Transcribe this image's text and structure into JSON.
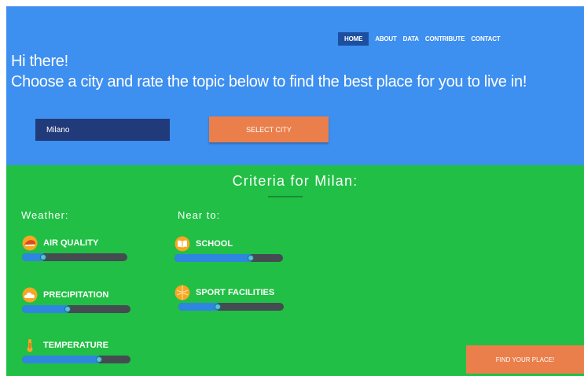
{
  "nav": {
    "items": [
      {
        "label": "HOME",
        "active": true
      },
      {
        "label": "ABOUT",
        "active": false
      },
      {
        "label": "DATA",
        "active": false
      },
      {
        "label": "CONTRIBUTE",
        "active": false
      },
      {
        "label": "CONTACT",
        "active": false
      }
    ]
  },
  "hero": {
    "line1": "Hi there!",
    "line2": "Choose a city and rate the topic below to find the best place for you to live in!",
    "city_value": "Milano",
    "select_label": "SELECT CITY"
  },
  "criteria": {
    "title": "Criteria for Milan:",
    "weather_heading": "Weather:",
    "near_heading": "Near to:",
    "weather": [
      {
        "label": "AIR QUALITY",
        "icon": "air-quality-icon",
        "level": 0.2
      },
      {
        "label": "PRECIPITATION",
        "icon": "cloud-icon",
        "level": 0.42
      },
      {
        "label": "TEMPERATURE",
        "icon": "thermometer-icon",
        "level": 0.71
      }
    ],
    "near": [
      {
        "label": "SCHOOL",
        "icon": "book-icon",
        "level": 0.7
      },
      {
        "label": "SPORT FACILITIES",
        "icon": "ball-icon",
        "level": 0.37
      }
    ]
  },
  "find_label": "FIND YOUR PLACE!",
  "colors": {
    "hero_bg": "#3d8ff0",
    "criteria_bg": "#21bf45",
    "accent_orange": "#ea7f4b",
    "nav_active": "#1d4fa0",
    "input_bg": "#213a7a",
    "slider_track": "#444c52",
    "slider_fill": "#2f86e0",
    "icon_orange": "#f5a623"
  }
}
